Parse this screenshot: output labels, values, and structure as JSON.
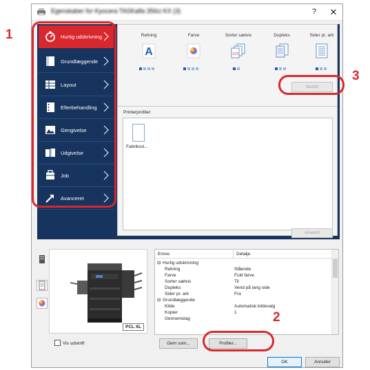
{
  "window": {
    "title": "Egenskaber for Kyocera TASKalfa 356ci KX (3)",
    "help_label": "?",
    "close_label": "✕"
  },
  "nav": {
    "items": [
      {
        "label": "Hurtig udskrivning",
        "icon": "quick-print-icon",
        "active": true
      },
      {
        "label": "Grundlæggende",
        "icon": "basic-icon",
        "active": false
      },
      {
        "label": "Layout",
        "icon": "layout-icon",
        "active": false
      },
      {
        "label": "Efterbehandling",
        "icon": "finishing-icon",
        "active": false
      },
      {
        "label": "Gengivelse",
        "icon": "imaging-icon",
        "active": false
      },
      {
        "label": "Udgivelse",
        "icon": "publishing-icon",
        "active": false
      },
      {
        "label": "Job",
        "icon": "job-icon",
        "active": false
      },
      {
        "label": "Avanceret",
        "icon": "advanced-icon",
        "active": false
      }
    ]
  },
  "quick_print": {
    "columns": [
      {
        "label": "Retning",
        "icon": "orientation-icon",
        "dots_total": 4,
        "dots_on": 1
      },
      {
        "label": "Farve",
        "icon": "color-icon",
        "dots_total": 4,
        "dots_on": 1
      },
      {
        "label": "Sorter sætvis",
        "icon": "collate-icon",
        "dots_total": 2,
        "dots_on": 1
      },
      {
        "label": "Dupleks",
        "icon": "duplex-icon",
        "dots_total": 3,
        "dots_on": 1
      },
      {
        "label": "Sider pr. ark",
        "icon": "pages-per-sheet-icon",
        "dots_total": 3,
        "dots_on": 1
      }
    ],
    "reset_label": "Nulstil",
    "profiles_label": "Printerprofiler:",
    "profile_item": "Fabriksst...",
    "apply_label": "Anvend"
  },
  "summary": {
    "printer_badge": "PCL XL",
    "headers": [
      "Emne",
      "Detalje"
    ],
    "rows": [
      {
        "item": "Hurtig udskrivning",
        "detail": "",
        "group": true
      },
      {
        "item": "Retning",
        "detail": "Stående",
        "group": false
      },
      {
        "item": "Farve",
        "detail": "Fuld farve",
        "group": false
      },
      {
        "item": "Sorter sætvis",
        "detail": "Til",
        "group": false
      },
      {
        "item": "Dupleks",
        "detail": "Vend på lang side",
        "group": false
      },
      {
        "item": "Sider pr. ark",
        "detail": "Fra",
        "group": false
      },
      {
        "item": "Grundlæggende",
        "detail": "",
        "group": true
      },
      {
        "item": "Kilde",
        "detail": "Automatisk kildevalg",
        "group": false
      },
      {
        "item": "Kopier",
        "detail": "1",
        "group": false
      },
      {
        "item": "Gennemslag",
        "detail": "",
        "group": false
      }
    ]
  },
  "footer": {
    "show_print_label": "Vis udskrift",
    "save_as_label": "Gem som...",
    "profiles_label": "Profiler...",
    "ok_label": "OK",
    "cancel_label": "Annuller"
  },
  "callouts": {
    "one": "1",
    "two": "2",
    "three": "3"
  },
  "colors": {
    "nav_bg": "#16345d",
    "active_red": "#d8282d",
    "callout_red": "#d8282d"
  }
}
